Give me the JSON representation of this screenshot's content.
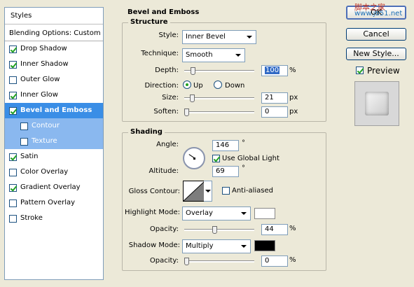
{
  "styles_panel": {
    "header": "Styles",
    "blending": "Blending Options: Custom",
    "items": [
      {
        "label": "Drop Shadow",
        "checked": true
      },
      {
        "label": "Inner Shadow",
        "checked": true
      },
      {
        "label": "Outer Glow",
        "checked": false
      },
      {
        "label": "Inner Glow",
        "checked": true
      },
      {
        "label": "Bevel and Emboss",
        "checked": true
      },
      {
        "label": "Contour",
        "checked": false
      },
      {
        "label": "Texture",
        "checked": false
      },
      {
        "label": "Satin",
        "checked": true
      },
      {
        "label": "Color Overlay",
        "checked": false
      },
      {
        "label": "Gradient Overlay",
        "checked": true
      },
      {
        "label": "Pattern Overlay",
        "checked": false
      },
      {
        "label": "Stroke",
        "checked": false
      }
    ]
  },
  "bevel": {
    "title": "Bevel and Emboss",
    "structure": {
      "title": "Structure",
      "style_label": "Style:",
      "style_value": "Inner Bevel",
      "technique_label": "Technique:",
      "technique_value": "Smooth",
      "depth_label": "Depth:",
      "depth_value": "100",
      "depth_unit": "%",
      "depth_level": 0.1,
      "direction_label": "Direction:",
      "dir_up": "Up",
      "dir_down": "Down",
      "size_label": "Size:",
      "size_value": "21",
      "size_unit": "px",
      "size_level": 0.085,
      "soften_label": "Soften:",
      "soften_value": "0",
      "soften_unit": "px",
      "soften_level": 0
    },
    "shading": {
      "title": "Shading",
      "angle_label": "Angle:",
      "angle_value": "146",
      "angle_unit": "°",
      "global_light": "Use Global Light",
      "global_light_checked": true,
      "altitude_label": "Altitude:",
      "altitude_value": "69",
      "altitude_unit": "°",
      "gloss_label": "Gloss Contour:",
      "anti_aliased": "Anti-aliased",
      "anti_aliased_checked": false,
      "highlight_label": "Highlight Mode:",
      "highlight_value": "Overlay",
      "highlight_color": "#ffffff",
      "hl_opacity_label": "Opacity:",
      "hl_opacity_value": "44",
      "hl_opacity_unit": "%",
      "hl_opacity_level": 0.44,
      "shadow_label": "Shadow Mode:",
      "shadow_value": "Multiply",
      "shadow_color": "#000000",
      "sh_opacity_label": "Opacity:",
      "sh_opacity_value": "0",
      "sh_opacity_unit": "%",
      "sh_opacity_level": 0
    }
  },
  "buttons": {
    "ok": "OK",
    "cancel": "Cancel",
    "new_style": "New Style...",
    "preview": "Preview",
    "preview_checked": true
  },
  "watermark": {
    "text": "脚本之家",
    "url": "www.jb51.net"
  }
}
